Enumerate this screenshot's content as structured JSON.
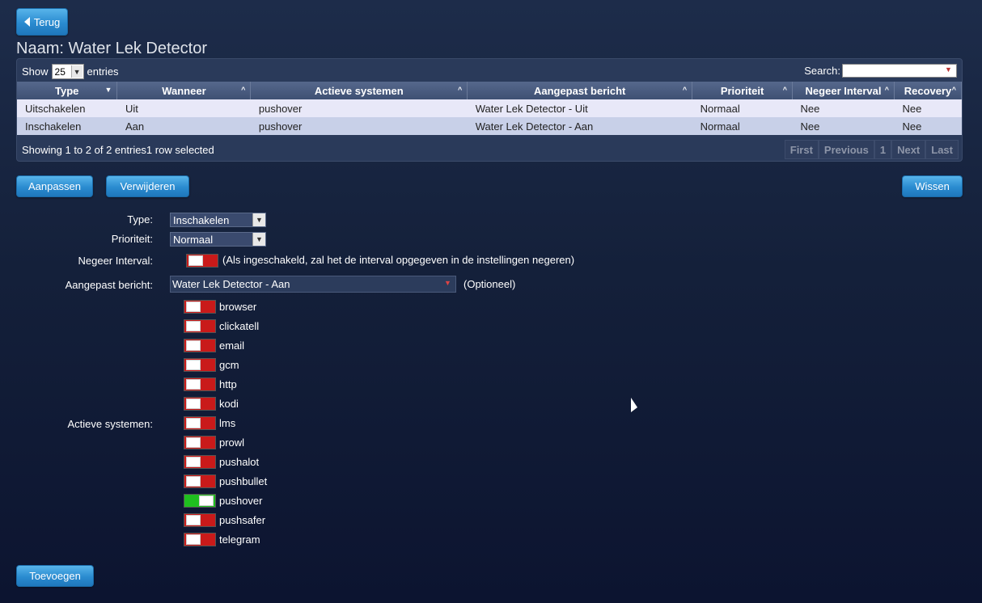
{
  "nav": {
    "back_label": "Terug"
  },
  "page": {
    "title": "Naam: Water Lek Detector"
  },
  "table": {
    "show_label": "Show",
    "show_value": "25",
    "entries_label": "entries",
    "search_label": "Search:",
    "search_value": "",
    "columns": [
      "Type",
      "Wanneer",
      "Actieve systemen",
      "Aangepast bericht",
      "Prioriteit",
      "Negeer Interval",
      "Recovery"
    ],
    "rows": [
      [
        "Uitschakelen",
        "Uit",
        "pushover",
        "Water Lek Detector - Uit",
        "Normaal",
        "Nee",
        "Nee"
      ],
      [
        "Inschakelen",
        "Aan",
        "pushover",
        "Water Lek Detector - Aan",
        "Normaal",
        "Nee",
        "Nee"
      ]
    ],
    "info": "Showing 1 to 2 of 2 entries1 row selected",
    "pager": {
      "first": "First",
      "previous": "Previous",
      "page": "1",
      "next": "Next",
      "last": "Last"
    }
  },
  "actions": {
    "edit": "Aanpassen",
    "delete": "Verwijderen",
    "clear": "Wissen",
    "add": "Toevoegen"
  },
  "form": {
    "type_label": "Type:",
    "type_value": "Inschakelen",
    "priority_label": "Prioriteit:",
    "priority_value": "Normaal",
    "ignore_label": "Negeer Interval:",
    "ignore_enabled": false,
    "ignore_hint": "(Als ingeschakeld, zal het de interval opgegeven in de instellingen negeren)",
    "message_label": "Aangepast bericht:",
    "message_value": "Water Lek Detector - Aan",
    "message_hint": "(Optioneel)",
    "systems_label": "Actieve systemen:",
    "systems": [
      {
        "name": "browser",
        "enabled": false
      },
      {
        "name": "clickatell",
        "enabled": false
      },
      {
        "name": "email",
        "enabled": false
      },
      {
        "name": "gcm",
        "enabled": false
      },
      {
        "name": "http",
        "enabled": false
      },
      {
        "name": "kodi",
        "enabled": false
      },
      {
        "name": "lms",
        "enabled": false
      },
      {
        "name": "prowl",
        "enabled": false
      },
      {
        "name": "pushalot",
        "enabled": false
      },
      {
        "name": "pushbullet",
        "enabled": false
      },
      {
        "name": "pushover",
        "enabled": true
      },
      {
        "name": "pushsafer",
        "enabled": false
      },
      {
        "name": "telegram",
        "enabled": false
      }
    ]
  },
  "colors": {
    "toggle_on": "#1fbf1f",
    "toggle_off": "#c91a1a",
    "button": "#2a8bd0"
  }
}
